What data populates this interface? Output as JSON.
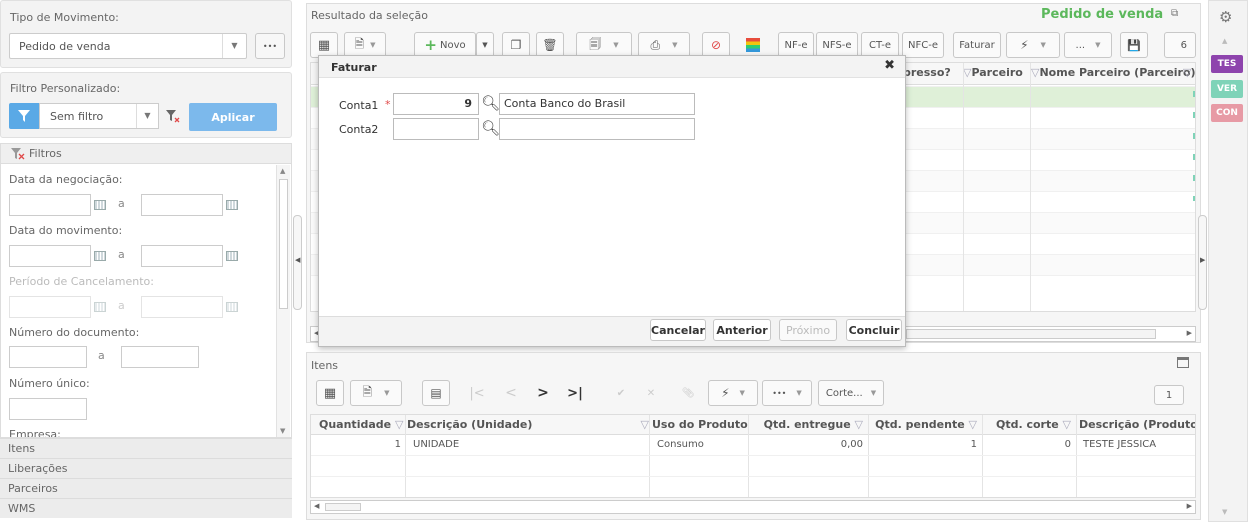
{
  "left": {
    "movement_type_label": "Tipo de Movimento:",
    "movement_type_value": "Pedido de venda",
    "more_label": "•••",
    "custom_filter_label": "Filtro Personalizado:",
    "filter_value": "Sem filtro",
    "apply_label": "Aplicar",
    "filters_header": "Filtros",
    "negotiation_date_label": "Data da negociação:",
    "movement_date_label": "Data do movimento:",
    "cancel_period_label": "Período de Cancelamento:",
    "range_sep": "a",
    "doc_number_label": "Número do documento:",
    "unique_number_label": "Número único:",
    "company_label": "Empresa:",
    "accordion": [
      "Itens",
      "Liberações",
      "Parceiros",
      "WMS"
    ]
  },
  "main": {
    "result_title": "Resultado da seleção",
    "context_title": "Pedido de venda",
    "toolbar": {
      "new_label": "Novo",
      "nfe": "NF-e",
      "nfse": "NFS-e",
      "cte": "CT-e",
      "nfce": "NFC-e",
      "invoice": "Faturar",
      "ellipsis": "...",
      "page_field": "6"
    },
    "grid_headers": [
      "pressо?",
      "Parceiro",
      "Nome Parceiro (Parceiro)"
    ],
    "dialog": {
      "title": "Faturar",
      "close": "✖",
      "conta1_label": "Conta1",
      "required_mark": "*",
      "conta1_value": "9",
      "conta1_desc": "Conta Banco do Brasil",
      "conta2_label": "Conta2",
      "conta2_value": "",
      "conta2_desc": "",
      "cancel": "Cancelar",
      "previous": "Anterior",
      "next": "Próximo",
      "finish": "Concluir"
    }
  },
  "items": {
    "title": "Itens",
    "cut_label": "Corte...",
    "page_field": "1",
    "headers": [
      "Quantidade",
      "Descrição (Unidade)",
      "Uso do Produto",
      "Qtd. entregue",
      "Qtd. pendente",
      "Qtd. corte",
      "Descrição (Produto)"
    ],
    "rows": [
      [
        "1",
        "UNIDADE",
        "Consumo",
        "0,00",
        "1",
        "0",
        "TESTE JESSICA"
      ]
    ]
  },
  "side": {
    "buttons": [
      {
        "label": "TES",
        "color": "#8e44ad"
      },
      {
        "label": "VER",
        "color": "#7fd3b8"
      },
      {
        "label": "CON",
        "color": "#e79aa5"
      }
    ]
  },
  "colors": {
    "accent_blue": "#5aa9e6",
    "context_green": "#5cb85c",
    "required_red": "#e04848"
  }
}
